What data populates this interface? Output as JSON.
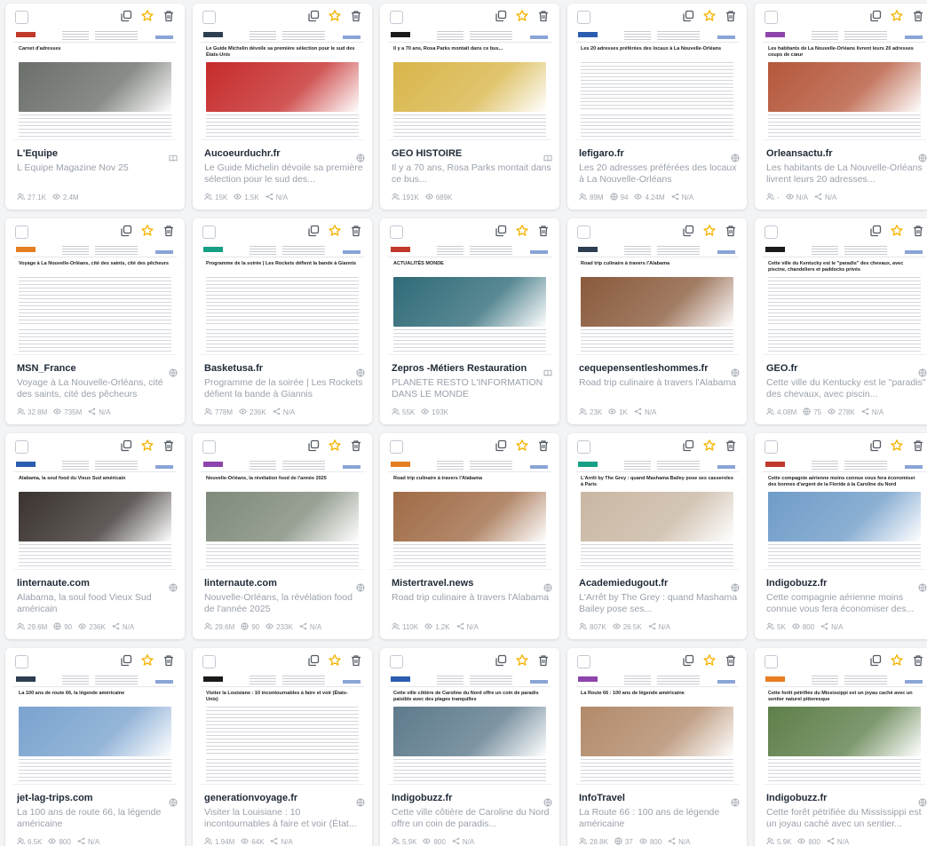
{
  "colors": {
    "star": "#f5b301",
    "icon": "#555b65",
    "muted": "#a3a9b2"
  },
  "cards": [
    {
      "source": "L'Equipe",
      "desc": "L Equipe Magazine Nov 25",
      "headline": "Carnet d'adresses",
      "img": "#6b6f6a",
      "icon": "book-icon",
      "stats": [
        {
          "icon": "reach-icon",
          "value": "27.1K"
        },
        {
          "icon": "views-icon",
          "value": "2.4M"
        }
      ]
    },
    {
      "source": "Aucoeurduchr.fr",
      "desc": "Le Guide Michelin dévoile sa première sélection pour le sud des...",
      "headline": "Le Guide Michelin dévoile sa première sélection pour le sud des États-Unis",
      "img": "#c62b2b",
      "icon": "globe-icon",
      "stats": [
        {
          "icon": "reach-icon",
          "value": "15K"
        },
        {
          "icon": "views-icon",
          "value": "1.5K"
        },
        {
          "icon": "share-icon",
          "value": "N/A"
        }
      ]
    },
    {
      "source": "GEO HISTOIRE",
      "desc": "Il y a 70 ans, Rosa Parks montait dans ce bus...",
      "headline": "Il y a 70 ans, Rosa Parks montait dans ce bus...",
      "img": "#d9b64a",
      "icon": "book-icon",
      "stats": [
        {
          "icon": "reach-icon",
          "value": "191K"
        },
        {
          "icon": "views-icon",
          "value": "689K"
        }
      ]
    },
    {
      "source": "lefigaro.fr",
      "desc": "Les 20 adresses préférées des locaux à La Nouvelle-Orléans",
      "headline": "Les 20 adresses préférées des locaux à La Nouvelle-Orléans",
      "img": "#ffffff",
      "icon": "globe-icon",
      "stats": [
        {
          "icon": "reach-icon",
          "value": "89M"
        },
        {
          "icon": "globe-icon",
          "value": "94"
        },
        {
          "icon": "views-icon",
          "value": "4.24M"
        },
        {
          "icon": "share-icon",
          "value": "N/A"
        }
      ]
    },
    {
      "source": "Orleansactu.fr",
      "desc": "Les habitants de La Nouvelle-Orléans livrent leurs 20 adresses...",
      "headline": "Les habitants de La Nouvelle-Orléans livrent leurs 20 adresses coups de cœur",
      "img": "#b5573a",
      "icon": "globe-icon",
      "stats": [
        {
          "icon": "reach-icon",
          "value": "-"
        },
        {
          "icon": "views-icon",
          "value": "N/A"
        },
        {
          "icon": "share-icon",
          "value": "N/A"
        }
      ]
    },
    {
      "source": "MSN_France",
      "desc": "Voyage à La Nouvelle-Orléans, cité des saints, cité des pêcheurs",
      "headline": "Voyage à La Nouvelle-Orléans, cité des saints, cité des pêcheurs",
      "img": "#ffffff",
      "icon": "globe-icon",
      "stats": [
        {
          "icon": "reach-icon",
          "value": "32.8M"
        },
        {
          "icon": "views-icon",
          "value": "735M"
        },
        {
          "icon": "share-icon",
          "value": "N/A"
        }
      ]
    },
    {
      "source": "Basketusa.fr",
      "desc": "Programme de la soirée | Les Rockets défient la bande à Giannis",
      "headline": "Programme de la soirée | Les Rockets défient la bande à Giannis",
      "img": "#ffffff",
      "icon": "globe-icon",
      "stats": [
        {
          "icon": "reach-icon",
          "value": "778M"
        },
        {
          "icon": "views-icon",
          "value": "236K"
        },
        {
          "icon": "share-icon",
          "value": "N/A"
        }
      ]
    },
    {
      "source": "Zepros -Métiers Restauration",
      "desc": "PLANETE RESTO L'INFORMATION DANS LE MONDE",
      "headline": "ACTUALITÉS MONDE",
      "img": "#2f6b78",
      "icon": "book-icon",
      "stats": [
        {
          "icon": "reach-icon",
          "value": "55K"
        },
        {
          "icon": "views-icon",
          "value": "193K"
        }
      ]
    },
    {
      "source": "cequepensentleshommes.fr",
      "desc": "Road trip culinaire à travers l'Alabama",
      "headline": "Road trip culinaire à travers l'Alabama",
      "img": "#8a5a3c",
      "icon": "globe-icon",
      "stats": [
        {
          "icon": "reach-icon",
          "value": "23K"
        },
        {
          "icon": "views-icon",
          "value": "1K"
        },
        {
          "icon": "share-icon",
          "value": "N/A"
        }
      ]
    },
    {
      "source": "GEO.fr",
      "desc": "Cette ville du Kentucky est le \"paradis\" des chevaux, avec piscin...",
      "headline": "Cette ville du Kentucky est le \"paradis\" des chevaux, avec piscine, chandeliers et paddocks privés",
      "img": "#ffffff",
      "icon": "globe-icon",
      "stats": [
        {
          "icon": "reach-icon",
          "value": "4.08M"
        },
        {
          "icon": "globe-icon",
          "value": "75"
        },
        {
          "icon": "views-icon",
          "value": "278K"
        },
        {
          "icon": "share-icon",
          "value": "N/A"
        }
      ]
    },
    {
      "source": "linternaute.com",
      "desc": "Alabama, la soul food Vieux Sud américain",
      "headline": "Alabama, la soul food du Vieux Sud américain",
      "img": "#3a3330",
      "icon": "globe-icon",
      "stats": [
        {
          "icon": "reach-icon",
          "value": "29.6M"
        },
        {
          "icon": "globe-icon",
          "value": "90"
        },
        {
          "icon": "views-icon",
          "value": "236K"
        },
        {
          "icon": "share-icon",
          "value": "N/A"
        }
      ]
    },
    {
      "source": "linternaute.com",
      "desc": "Nouvelle-Orléans, la révélation food de l'année 2025",
      "headline": "Nouvelle-Orléans, la révélation food de l'année 2025",
      "img": "#7f8a7a",
      "icon": "globe-icon",
      "stats": [
        {
          "icon": "reach-icon",
          "value": "29.6M"
        },
        {
          "icon": "globe-icon",
          "value": "90"
        },
        {
          "icon": "views-icon",
          "value": "233K"
        },
        {
          "icon": "share-icon",
          "value": "N/A"
        }
      ]
    },
    {
      "source": "Mistertravel.news",
      "desc": "Road trip culinaire à travers l'Alabama",
      "headline": "Road trip culinaire à travers l'Alabama",
      "img": "#a06b46",
      "icon": "globe-icon",
      "stats": [
        {
          "icon": "reach-icon",
          "value": "110K"
        },
        {
          "icon": "views-icon",
          "value": "1.2K"
        },
        {
          "icon": "share-icon",
          "value": "N/A"
        }
      ]
    },
    {
      "source": "Academiedugout.fr",
      "desc": "L'Arrêt by The Grey : quand Mashama Bailey pose ses...",
      "headline": "L'Arrêt by The Grey : quand Mashama Bailey pose ses casseroles à Paris",
      "img": "#c9b7a3",
      "icon": "globe-icon",
      "stats": [
        {
          "icon": "reach-icon",
          "value": "807K"
        },
        {
          "icon": "views-icon",
          "value": "26.5K"
        },
        {
          "icon": "share-icon",
          "value": "N/A"
        }
      ]
    },
    {
      "source": "Indigobuzz.fr",
      "desc": "Cette compagnie aérienne moins connue vous fera économiser des...",
      "headline": "Cette compagnie aérienne moins connue vous fera économiser des bonnes d'argent de la Floride à la Caroline du Nord",
      "img": "#6f9cc8",
      "icon": "globe-icon",
      "stats": [
        {
          "icon": "reach-icon",
          "value": "5K"
        },
        {
          "icon": "views-icon",
          "value": "800"
        },
        {
          "icon": "share-icon",
          "value": "N/A"
        }
      ]
    },
    {
      "source": "jet-lag-trips.com",
      "desc": "La 100 ans de route 66, la légende américaine",
      "headline": "La 100 ans de route 66, la légende américaine",
      "img": "#7aa3cf",
      "icon": "globe-icon",
      "stats": [
        {
          "icon": "reach-icon",
          "value": "6.5K"
        },
        {
          "icon": "views-icon",
          "value": "800"
        },
        {
          "icon": "share-icon",
          "value": "N/A"
        }
      ]
    },
    {
      "source": "generationvoyage.fr",
      "desc": "Visiter la Louisiane : 10 incontournables à faire et voir (État...",
      "headline": "Visiter la Louisiane : 10 incontournables à faire et voir (États-Unis)",
      "img": "#ffffff",
      "icon": "globe-icon",
      "stats": [
        {
          "icon": "reach-icon",
          "value": "1.94M"
        },
        {
          "icon": "views-icon",
          "value": "64K"
        },
        {
          "icon": "share-icon",
          "value": "N/A"
        }
      ]
    },
    {
      "source": "Indigobuzz.fr",
      "desc": "Cette ville côtière de Caroline du Nord offre un coin de paradis...",
      "headline": "Cette ville côtière de Caroline du Nord offre un coin de paradis paisible avec des plages tranquilles",
      "img": "#5d7a8c",
      "icon": "globe-icon",
      "stats": [
        {
          "icon": "reach-icon",
          "value": "5.9K"
        },
        {
          "icon": "views-icon",
          "value": "800"
        },
        {
          "icon": "share-icon",
          "value": "N/A"
        }
      ]
    },
    {
      "source": "InfoTravel",
      "desc": "La Route 66 : 100 ans de légende américaine",
      "headline": "La Route 66 : 100 ans de légende américaine",
      "img": "#b28a6a",
      "icon": "globe-icon",
      "stats": [
        {
          "icon": "reach-icon",
          "value": "28.8K"
        },
        {
          "icon": "globe-icon",
          "value": "37"
        },
        {
          "icon": "views-icon",
          "value": "800"
        },
        {
          "icon": "share-icon",
          "value": "N/A"
        }
      ]
    },
    {
      "source": "Indigobuzz.fr",
      "desc": "Cette forêt pétrifiée du Mississippi est un joyau caché avec un sentier...",
      "headline": "Cette forêt pétrifiée du Mississippi est un joyau caché avec un sentier naturel pittoresque",
      "img": "#5e7f4a",
      "icon": "globe-icon",
      "stats": [
        {
          "icon": "reach-icon",
          "value": "5.9K"
        },
        {
          "icon": "views-icon",
          "value": "800"
        },
        {
          "icon": "share-icon",
          "value": "N/A"
        }
      ]
    }
  ]
}
